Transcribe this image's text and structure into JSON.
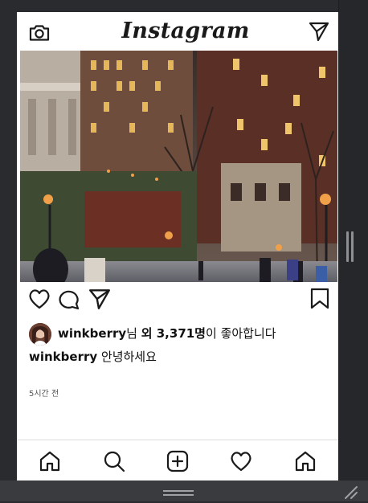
{
  "app": {
    "brand": "Instagram"
  },
  "post": {
    "likes": {
      "user": "winkberry",
      "suffix_1": "님 ",
      "others": "외 3,371명",
      "suffix_2": "이 좋아합니다"
    },
    "caption": {
      "user": "winkberry",
      "text": " 안녕하세요"
    },
    "time": "5시간 전"
  },
  "icons": {
    "top_left": "camera-icon",
    "top_right": "send-icon",
    "actions": [
      "heart-icon",
      "comment-icon",
      "share-icon",
      "bookmark-icon"
    ],
    "tabs": [
      "home-icon",
      "search-icon",
      "add-post-icon",
      "activity-heart-icon",
      "home-icon"
    ]
  },
  "colors": {
    "icon": "#1a1a1a",
    "text": "#111111",
    "muted": "#555555",
    "divider": "#dcdcdc"
  }
}
